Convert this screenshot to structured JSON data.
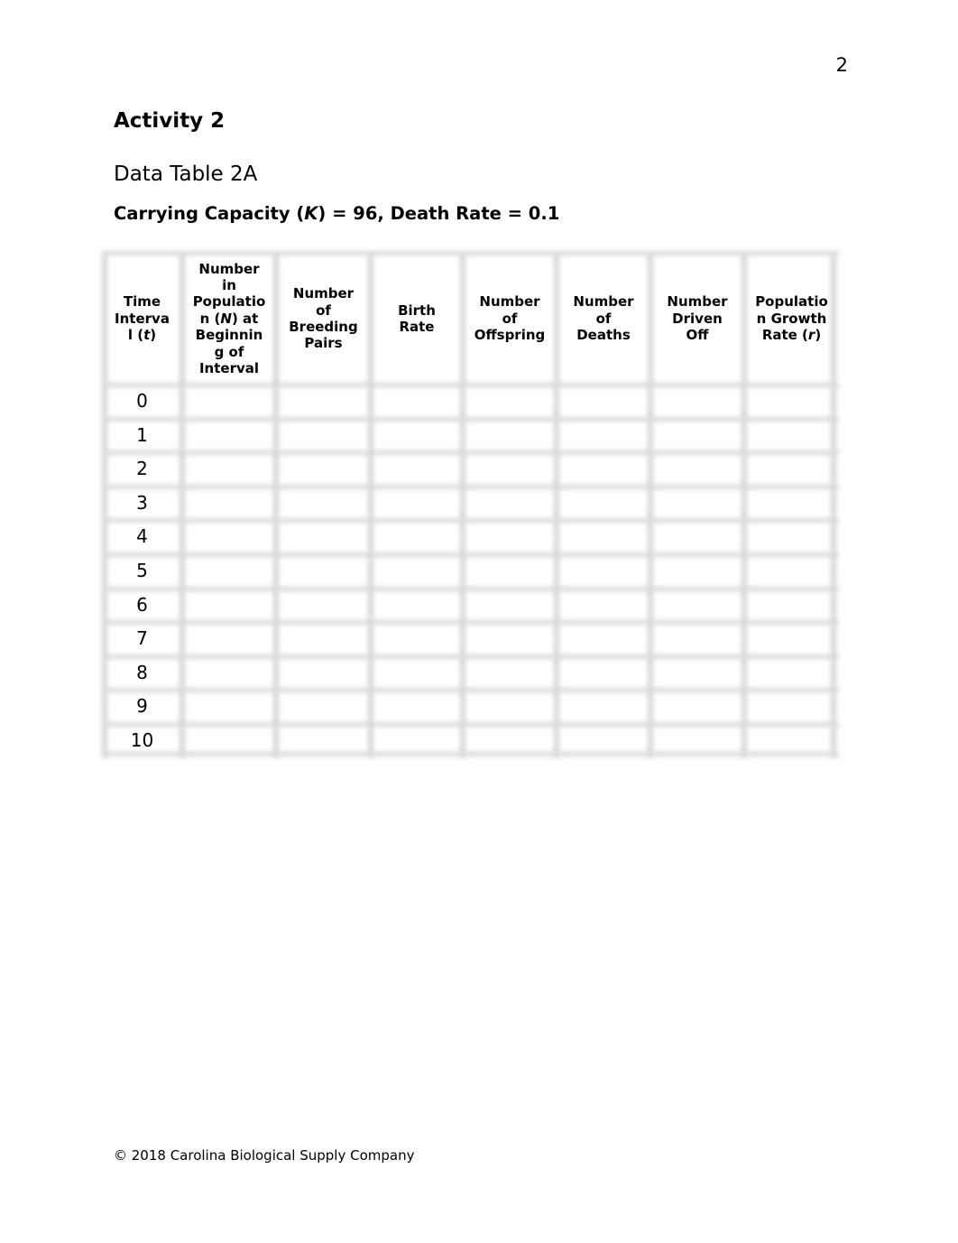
{
  "page": {
    "number": "2",
    "activity_title": "Activity 2",
    "table_title": "Data Table 2A",
    "subtitle": {
      "prefix": "Carrying Capacity (",
      "var": "K",
      "suffix": ") = 96, Death Rate = 0.1"
    },
    "footer": "© 2018 Carolina Biological Supply Company"
  },
  "table": {
    "columns": [
      {
        "lines": [
          "Time",
          "Interva",
          "l (",
          "t",
          ")"
        ],
        "label": "Time Interval (t)"
      },
      {
        "lines": [
          "Number",
          "in",
          "Populatio",
          "n (",
          "N",
          ") at",
          "Beginnin",
          "g of",
          "Interval"
        ],
        "label": "Number in Population (N) at Beginning of Interval"
      },
      {
        "lines": [
          "Number",
          "of",
          "Breeding",
          "Pairs"
        ],
        "label": "Number of Breeding Pairs"
      },
      {
        "lines": [
          "Birth",
          "Rate"
        ],
        "label": "Birth Rate"
      },
      {
        "lines": [
          "Number",
          "of",
          "Offspring"
        ],
        "label": "Number of Offspring"
      },
      {
        "lines": [
          "Number",
          "of",
          "Deaths"
        ],
        "label": "Number of Deaths"
      },
      {
        "lines": [
          "Number",
          "Driven",
          "Off"
        ],
        "label": "Number Driven Off"
      },
      {
        "lines": [
          "Populatio",
          "n Growth",
          "Rate (",
          "r",
          ")"
        ],
        "label": "Population Growth Rate (r)"
      }
    ],
    "rows": [
      {
        "t": "0",
        "cells": [
          "",
          "",
          "",
          "",
          "",
          "",
          ""
        ]
      },
      {
        "t": "1",
        "cells": [
          "",
          "",
          "",
          "",
          "",
          "",
          ""
        ]
      },
      {
        "t": "2",
        "cells": [
          "",
          "",
          "",
          "",
          "",
          "",
          ""
        ]
      },
      {
        "t": "3",
        "cells": [
          "",
          "",
          "",
          "",
          "",
          "",
          ""
        ]
      },
      {
        "t": "4",
        "cells": [
          "",
          "",
          "",
          "",
          "",
          "",
          ""
        ]
      },
      {
        "t": "5",
        "cells": [
          "",
          "",
          "",
          "",
          "",
          "",
          ""
        ]
      },
      {
        "t": "6",
        "cells": [
          "",
          "",
          "",
          "",
          "",
          "",
          ""
        ]
      },
      {
        "t": "7",
        "cells": [
          "",
          "",
          "",
          "",
          "",
          "",
          ""
        ]
      },
      {
        "t": "8",
        "cells": [
          "",
          "",
          "",
          "",
          "",
          "",
          ""
        ]
      },
      {
        "t": "9",
        "cells": [
          "",
          "",
          "",
          "",
          "",
          "",
          ""
        ]
      },
      {
        "t": "10",
        "cells": [
          "",
          "",
          "",
          "",
          "",
          "",
          ""
        ]
      }
    ]
  }
}
